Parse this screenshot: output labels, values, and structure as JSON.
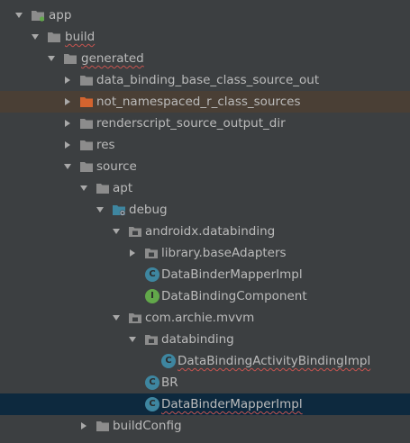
{
  "colors": {
    "background": "#3c3f41",
    "text": "#bbbbbb",
    "folder": "#8c8c8c",
    "excluded_folder": "#d3642f",
    "class_badge": "#3e86a0",
    "interface_badge": "#62a84a",
    "selected_row": "#0d293e",
    "highlighted_row": "#4a3f35"
  },
  "tree": {
    "app": {
      "label": "app",
      "icon": "module-folder-icon",
      "expanded": true
    },
    "build": {
      "label": "build",
      "icon": "folder-icon",
      "expanded": true
    },
    "generated": {
      "label": "generated",
      "icon": "folder-icon",
      "expanded": true
    },
    "data_binding_base_class_source_out": {
      "label": "data_binding_base_class_source_out",
      "icon": "folder-icon",
      "expanded": false
    },
    "not_namespaced_r_class_sources": {
      "label": "not_namespaced_r_class_sources",
      "icon": "excluded-folder-icon",
      "expanded": false
    },
    "renderscript_source_output_dir": {
      "label": "renderscript_source_output_dir",
      "icon": "folder-icon",
      "expanded": false
    },
    "res": {
      "label": "res",
      "icon": "folder-icon",
      "expanded": false
    },
    "source": {
      "label": "source",
      "icon": "folder-icon",
      "expanded": true
    },
    "apt": {
      "label": "apt",
      "icon": "folder-icon",
      "expanded": true
    },
    "debug": {
      "label": "debug",
      "icon": "generated-source-folder-icon",
      "expanded": true
    },
    "androidx_databinding": {
      "label": "androidx.databinding",
      "icon": "package-icon",
      "expanded": true
    },
    "library_baseAdapters": {
      "label": "library.baseAdapters",
      "icon": "package-icon",
      "expanded": false
    },
    "DataBinderMapperImpl_1": {
      "label": "DataBinderMapperImpl",
      "badge": "C"
    },
    "DataBindingComponent": {
      "label": "DataBindingComponent",
      "badge": "I"
    },
    "com_archie_mvvm": {
      "label": "com.archie.mvvm",
      "icon": "package-icon",
      "expanded": true
    },
    "databinding": {
      "label": "databinding",
      "icon": "package-icon",
      "expanded": true
    },
    "DataBindingActivityBindingImpl": {
      "label": "DataBindingActivityBindingImpl",
      "badge": "C"
    },
    "BR": {
      "label": "BR",
      "badge": "C"
    },
    "DataBinderMapperImpl_2": {
      "label": "DataBinderMapperImpl",
      "badge": "C",
      "selected": true
    },
    "buildConfig": {
      "label": "buildConfig",
      "icon": "folder-icon",
      "expanded": false
    }
  }
}
